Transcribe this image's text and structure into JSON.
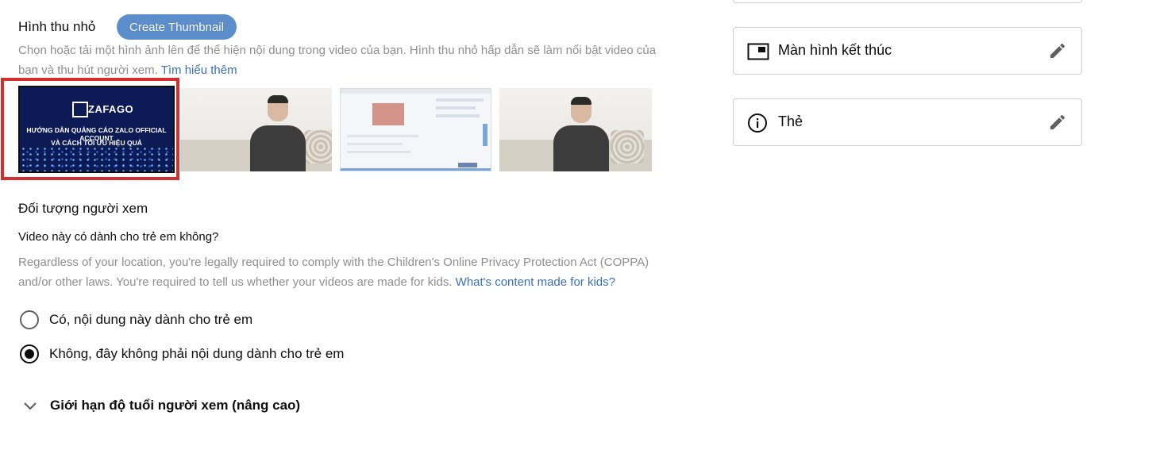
{
  "thumbnail": {
    "title": "Hình thu nhỏ",
    "create_button": "Create Thumbnail",
    "description": "Chọn hoặc tải một hình ảnh lên để thể hiện nội dung trong video của bạn. Hình thu nhỏ hấp dẫn sẽ làm nổi bật video của",
    "description_line2": "bạn và thu hút người xem.",
    "learn_more": "Tìm hiểu thêm",
    "selected_thumb": {
      "logo": "ZAFAGO",
      "headline_line1": "HƯỚNG DẪN QUẢNG CÁO ZALO OFFICIAL ACCOUNT",
      "headline_line2": "VÀ CÁCH TỐI ƯU HIỆU QUẢ"
    },
    "selected_border_color": "#d32f2f"
  },
  "audience": {
    "title": "Đối tượng người xem",
    "question": "Video này có dành cho trẻ em không?",
    "coppa_line1": "Regardless of your location, you're legally required to comply with the Children's Online Privacy Protection Act (COPPA)",
    "coppa_line2": "and/or other laws. You're required to tell us whether your videos are made for kids.",
    "coppa_link": "What's content made for kids?",
    "option_yes": "Có, nội dung này dành cho trẻ em",
    "option_no": "Không, đây không phải nội dung dành cho trẻ em",
    "selected": "no",
    "age_restriction": "Giới hạn độ tuổi người xem (nâng cao)"
  },
  "sidebar": {
    "end_screen": "Màn hình kết thúc",
    "cards": "Thẻ"
  },
  "icons": {
    "end_screen": "end-screen-icon",
    "cards": "info-icon",
    "edit": "pencil-icon",
    "expand": "chevron-down-icon"
  },
  "colors": {
    "accent_button": "#5b8ecb",
    "link": "#3a6fb5",
    "selection_box": "#d32f2f"
  }
}
